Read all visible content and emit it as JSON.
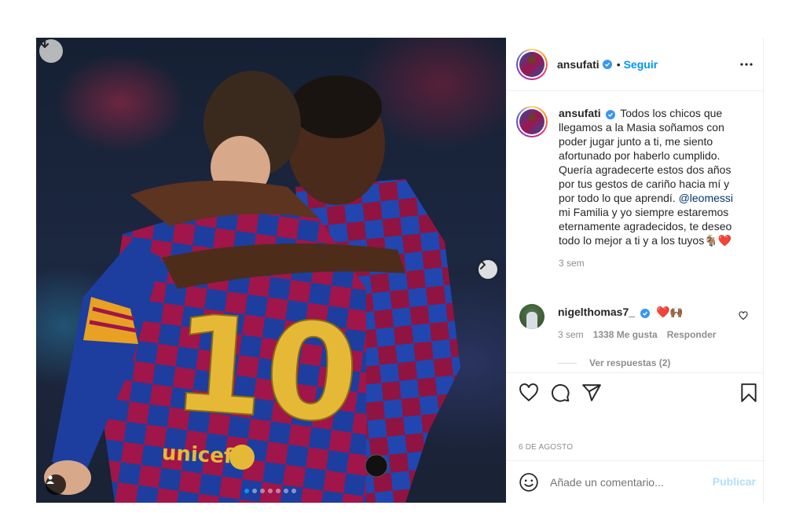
{
  "post": {
    "author": "ansufati",
    "follow_label": "Seguir",
    "dot": "•",
    "date": "6 de agosto",
    "carousel": {
      "total": 7,
      "active_index": 0
    }
  },
  "caption": {
    "author": "ansufati",
    "text_part1": "Todos los chicos que llegamos a la Masia soñamos con poder jugar junto a ti, me siento afortunado por haberlo cumplido. Quería agradecerte estos dos años por tus gestos de cariño hacia mí y por todo lo que aprendí.",
    "mention": "@leomessi",
    "text_part2": "mi Familia y yo siempre estaremos eternamente agradecidos, te deseo todo lo mejor a ti y a los tuyos",
    "emoji": "🐐❤️",
    "time": "3 sem"
  },
  "reply": {
    "author": "nigelthomas7_",
    "emoji": "❤️🙌🏾",
    "time": "3 sem",
    "likes": "1338 Me gusta",
    "reply_label": "Responder"
  },
  "view_replies_label": "Ver respuestas (2)",
  "add_comment": {
    "placeholder": "Añade un comentario...",
    "publish_label": "Publicar"
  },
  "colors": {
    "accent": "#0095f6",
    "verified": "#3897f0",
    "publish_disabled": "#b2dffc",
    "jersey_blue": "#1d3e9e",
    "jersey_red": "#a0154a",
    "number_gold": "#e5b936"
  },
  "icons": [
    "download-icon",
    "chevron-right-icon",
    "user-tag-icon",
    "verified-icon",
    "more-options-icon",
    "heart-icon",
    "comment-icon",
    "share-icon",
    "bookmark-icon",
    "emoji-icon"
  ]
}
